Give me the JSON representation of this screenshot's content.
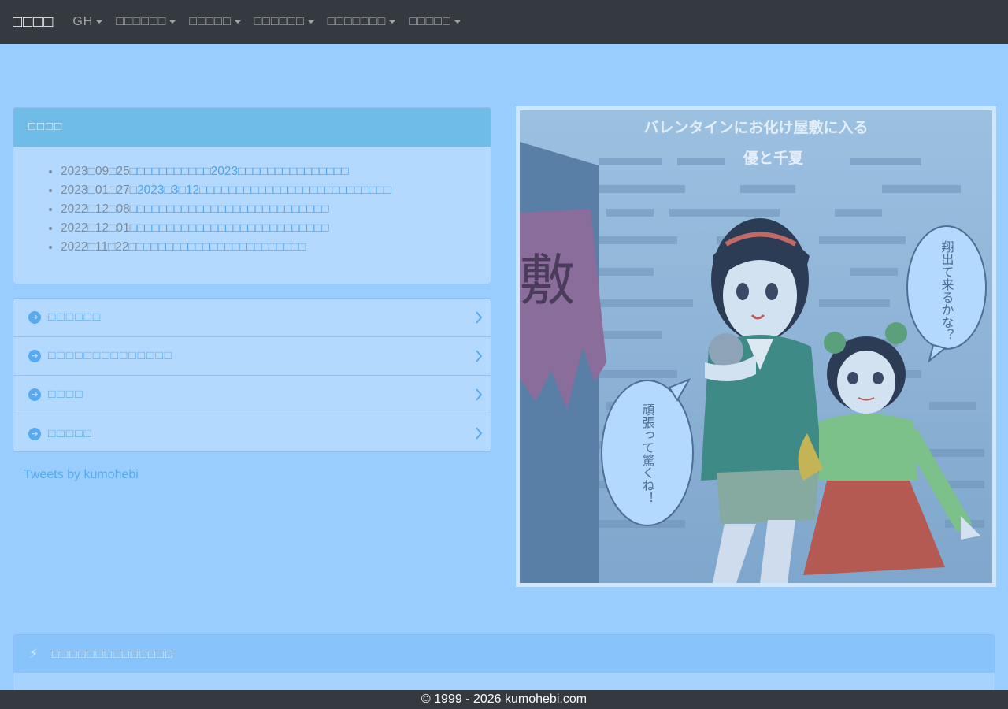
{
  "navbar": {
    "brand": "□□□□",
    "items": [
      {
        "label": "GH"
      },
      {
        "label": "□□□□□□"
      },
      {
        "label": "□□□□□"
      },
      {
        "label": "□□□□□□"
      },
      {
        "label": "□□□□□□□"
      },
      {
        "label": "□□□□□"
      }
    ]
  },
  "news": {
    "header": "□□□□",
    "items": [
      {
        "date": "2023□09□25□",
        "link": "□□□□□□□□□□2023□□□□□□□□□□□□□□□"
      },
      {
        "date": "2023□01□27□",
        "link": "2023□3□12□□□□□□□□□□□□□□□□□□□□□□□□□□"
      },
      {
        "date": "2022□12□08□",
        "link": "□□□□□□□□□□□□□□□□□□□□□□□□□□"
      },
      {
        "date": "2022□12□01□",
        "link": "□□□□□□□□□□□□□□□□□□□□□□□□□□"
      },
      {
        "date": "2022□11□22□",
        "link": "□□□□□□□□□□□□□□□□□□□□□□□"
      }
    ]
  },
  "links": [
    {
      "label": "□□□□□□"
    },
    {
      "label": "□□□□□□□□□□□□□□"
    },
    {
      "label": "□□□□"
    },
    {
      "label": "□□□□□"
    }
  ],
  "tweets_link": "Tweets by kumohebi",
  "illustration": {
    "title_line1": "バレンタインにお化け屋敷に入る",
    "title_line2": "優と千夏",
    "bubble_right": "翔出て来るかな？",
    "bubble_left": "頑張って驚くね！",
    "sign": "敷"
  },
  "lower_card": {
    "header": "□□□□□□□□□□□□□□"
  },
  "footer": "© 1999 - 2026 kumohebi.com"
}
